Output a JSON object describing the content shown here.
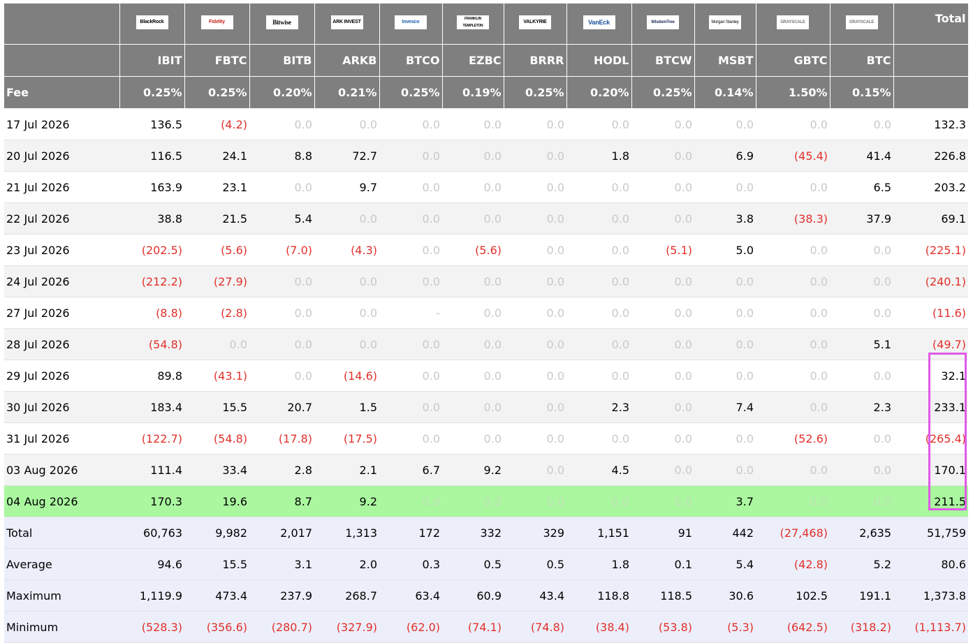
{
  "header": {
    "issuers": [
      "BlackRock",
      "Fidelity",
      "Bitwise",
      "ARK INVEST",
      "Invesco",
      "FRANKLIN TEMPLETON",
      "VALKYRIE",
      "VanEck",
      "WisdomTree",
      "Morgan Stanley",
      "GRAYSCALE",
      "GRAYSCALE"
    ],
    "total_label": "Total",
    "tickers": [
      "IBIT",
      "FBTC",
      "BITB",
      "ARKB",
      "BTCO",
      "EZBC",
      "BRRR",
      "HODL",
      "BTCW",
      "MSBT",
      "GBTC",
      "BTC"
    ],
    "fee_label": "Fee",
    "fees": [
      "0.25%",
      "0.25%",
      "0.20%",
      "0.21%",
      "0.25%",
      "0.19%",
      "0.25%",
      "0.20%",
      "0.25%",
      "0.14%",
      "1.50%",
      "0.15%"
    ]
  },
  "rows": [
    {
      "date": "17 Jul 2026",
      "values": [
        "136.5",
        "(4.2)",
        "0.0",
        "0.0",
        "0.0",
        "0.0",
        "0.0",
        "0.0",
        "0.0",
        "0.0",
        "0.0",
        "0.0"
      ],
      "total": "132.3"
    },
    {
      "date": "20 Jul 2026",
      "values": [
        "116.5",
        "24.1",
        "8.8",
        "72.7",
        "0.0",
        "0.0",
        "0.0",
        "1.8",
        "0.0",
        "6.9",
        "(45.4)",
        "41.4"
      ],
      "total": "226.8"
    },
    {
      "date": "21 Jul 2026",
      "values": [
        "163.9",
        "23.1",
        "0.0",
        "9.7",
        "0.0",
        "0.0",
        "0.0",
        "0.0",
        "0.0",
        "0.0",
        "0.0",
        "6.5"
      ],
      "total": "203.2"
    },
    {
      "date": "22 Jul 2026",
      "values": [
        "38.8",
        "21.5",
        "5.4",
        "0.0",
        "0.0",
        "0.0",
        "0.0",
        "0.0",
        "0.0",
        "3.8",
        "(38.3)",
        "37.9"
      ],
      "total": "69.1"
    },
    {
      "date": "23 Jul 2026",
      "values": [
        "(202.5)",
        "(5.6)",
        "(7.0)",
        "(4.3)",
        "0.0",
        "(5.6)",
        "0.0",
        "0.0",
        "(5.1)",
        "5.0",
        "0.0",
        "0.0"
      ],
      "total": "(225.1)"
    },
    {
      "date": "24 Jul 2026",
      "values": [
        "(212.2)",
        "(27.9)",
        "0.0",
        "0.0",
        "0.0",
        "0.0",
        "0.0",
        "0.0",
        "0.0",
        "0.0",
        "0.0",
        "0.0"
      ],
      "total": "(240.1)"
    },
    {
      "date": "27 Jul 2026",
      "values": [
        "(8.8)",
        "(2.8)",
        "0.0",
        "0.0",
        "-",
        "0.0",
        "0.0",
        "0.0",
        "0.0",
        "0.0",
        "0.0",
        "0.0"
      ],
      "total": "(11.6)"
    },
    {
      "date": "28 Jul 2026",
      "values": [
        "(54.8)",
        "0.0",
        "0.0",
        "0.0",
        "0.0",
        "0.0",
        "0.0",
        "0.0",
        "0.0",
        "0.0",
        "0.0",
        "5.1"
      ],
      "total": "(49.7)"
    },
    {
      "date": "29 Jul 2026",
      "values": [
        "89.8",
        "(43.1)",
        "0.0",
        "(14.6)",
        "0.0",
        "0.0",
        "0.0",
        "0.0",
        "0.0",
        "0.0",
        "0.0",
        "0.0"
      ],
      "total": "32.1"
    },
    {
      "date": "30 Jul 2026",
      "values": [
        "183.4",
        "15.5",
        "20.7",
        "1.5",
        "0.0",
        "0.0",
        "0.0",
        "2.3",
        "0.0",
        "7.4",
        "0.0",
        "2.3"
      ],
      "total": "233.1"
    },
    {
      "date": "31 Jul 2026",
      "values": [
        "(122.7)",
        "(54.8)",
        "(17.8)",
        "(17.5)",
        "0.0",
        "0.0",
        "0.0",
        "0.0",
        "0.0",
        "0.0",
        "(52.6)",
        "0.0"
      ],
      "total": "(265.4)"
    },
    {
      "date": "03 Aug 2026",
      "values": [
        "111.4",
        "33.4",
        "2.8",
        "2.1",
        "6.7",
        "9.2",
        "0.0",
        "4.5",
        "0.0",
        "0.0",
        "0.0",
        "0.0"
      ],
      "total": "170.1"
    },
    {
      "date": "04 Aug 2026",
      "values": [
        "170.3",
        "19.6",
        "8.7",
        "9.2",
        "0.0",
        "0.0",
        "0.0",
        "0.0",
        "0.0",
        "3.7",
        "0.0",
        "0.0"
      ],
      "total": "211.5"
    }
  ],
  "stats": [
    {
      "label": "Total",
      "values": [
        "60,763",
        "9,982",
        "2,017",
        "1,313",
        "172",
        "332",
        "329",
        "1,151",
        "91",
        "442",
        "(27,468)",
        "2,635"
      ],
      "total": "51,759"
    },
    {
      "label": "Average",
      "values": [
        "94.6",
        "15.5",
        "3.1",
        "2.0",
        "0.3",
        "0.5",
        "0.5",
        "1.8",
        "0.1",
        "5.4",
        "(42.8)",
        "5.2"
      ],
      "total": "80.6"
    },
    {
      "label": "Maximum",
      "values": [
        "1,119.9",
        "473.4",
        "237.9",
        "268.7",
        "63.4",
        "60.9",
        "43.4",
        "118.8",
        "118.5",
        "30.6",
        "102.5",
        "191.1"
      ],
      "total": "1,373.8"
    },
    {
      "label": "Minimum",
      "values": [
        "(528.3)",
        "(356.6)",
        "(280.7)",
        "(327.9)",
        "(62.0)",
        "(74.1)",
        "(74.8)",
        "(38.4)",
        "(53.8)",
        "(5.3)",
        "(642.5)",
        "(318.2)"
      ],
      "total": "(1,113.7)"
    }
  ],
  "colors": {
    "header_bg": "#7f7f7f",
    "negative": "#e2302a",
    "zero": "#c9c9c9",
    "highlight_row": "#aaf7a0",
    "stats_bg": "#eceffa",
    "highlight_box": "#e05ae6"
  }
}
